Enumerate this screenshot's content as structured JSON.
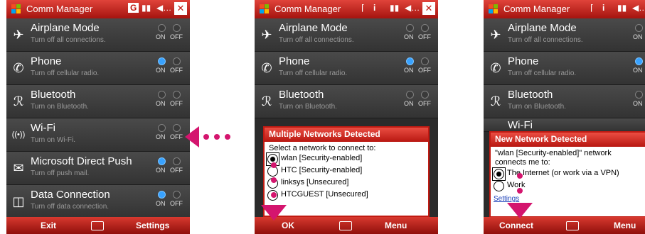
{
  "screen1": {
    "title": "Comm Manager",
    "status": "G",
    "signal_icon": "signal-icon",
    "rows": [
      {
        "name": "Airplane Mode",
        "desc": "Turn off all connections.",
        "icon": "airplane-icon",
        "state": "none"
      },
      {
        "name": "Phone",
        "desc": "Turn off cellular radio.",
        "icon": "phone-icon",
        "state": "on"
      },
      {
        "name": "Bluetooth",
        "desc": "Turn on Bluetooth.",
        "icon": "bluetooth-icon",
        "state": "none"
      },
      {
        "name": "Wi-Fi",
        "desc": "Turn on Wi-Fi.",
        "icon": "wifi-icon",
        "state": "none"
      },
      {
        "name": "Microsoft Direct Push",
        "desc": "Turn off push mail.",
        "icon": "mail-icon",
        "state": "on"
      },
      {
        "name": "Data Connection",
        "desc": "Turn off data connection.",
        "icon": "data-icon",
        "state": "on"
      }
    ],
    "toggle_on": "ON",
    "toggle_off": "OFF",
    "left_soft": "Exit",
    "right_soft": "Settings"
  },
  "screen2": {
    "title": "Comm Manager",
    "rows": [
      {
        "name": "Airplane Mode",
        "desc": "Turn off all connections.",
        "state": "none"
      },
      {
        "name": "Phone",
        "desc": "Turn off cellular radio.",
        "state": "on"
      },
      {
        "name": "Bluetooth",
        "desc": "Turn on Bluetooth.",
        "state": "none"
      }
    ],
    "dialog_title": "Multiple Networks Detected",
    "dialog_text": "Select a network to connect to:",
    "options": [
      "wlan [Security-enabled]",
      "HTC [Security-enabled]",
      "linksys [Unsecured]",
      "HTCGUEST [Unsecured]"
    ],
    "selected": 0,
    "left_soft": "OK",
    "right_soft": "Menu"
  },
  "screen3": {
    "title": "Comm Manager",
    "rows": [
      {
        "name": "Airplane Mode",
        "desc": "Turn off all connections.",
        "state": "none"
      },
      {
        "name": "Phone",
        "desc": "Turn off cellular radio.",
        "state": "on"
      },
      {
        "name": "Bluetooth",
        "desc": "Turn on Bluetooth.",
        "state": "none"
      }
    ],
    "partial_row": "Wi-Fi",
    "dialog_title": "New Network Detected",
    "dialog_text": "\"wlan [Security-enabled]\" network connects me to:",
    "options": [
      "The Internet (or work via a VPN)",
      "Work"
    ],
    "selected": 0,
    "settings_link": "Settings",
    "left_soft": "Connect",
    "right_soft": "Menu"
  },
  "colors": {
    "accent": "#c41a13",
    "toggle_on": "#38a2ff",
    "annotation": "#d4156e"
  }
}
